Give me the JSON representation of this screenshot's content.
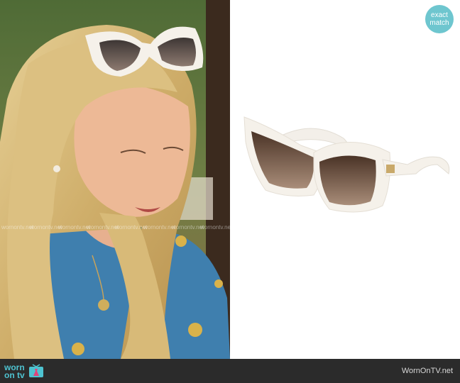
{
  "badge": {
    "line1": "exact",
    "line2": "match"
  },
  "footer": {
    "brand_word_1": "worn",
    "brand_word_2": "on tv",
    "site": "WornOnTV.net"
  },
  "watermarks": [
    "wornontv.net",
    "wornontv.net",
    "wornontv.net",
    "wornontv.net",
    "wornontv.net",
    "wornontv.net",
    "wornontv.net",
    "wornontv.net"
  ],
  "icons": {
    "tv": "tv-dress-icon"
  },
  "colors": {
    "accent": "#4ec3d1",
    "badge": "#6ec6cf",
    "footer": "#2b2b2b",
    "frame": "#f5f1ea",
    "lens": "#6b4a35"
  }
}
